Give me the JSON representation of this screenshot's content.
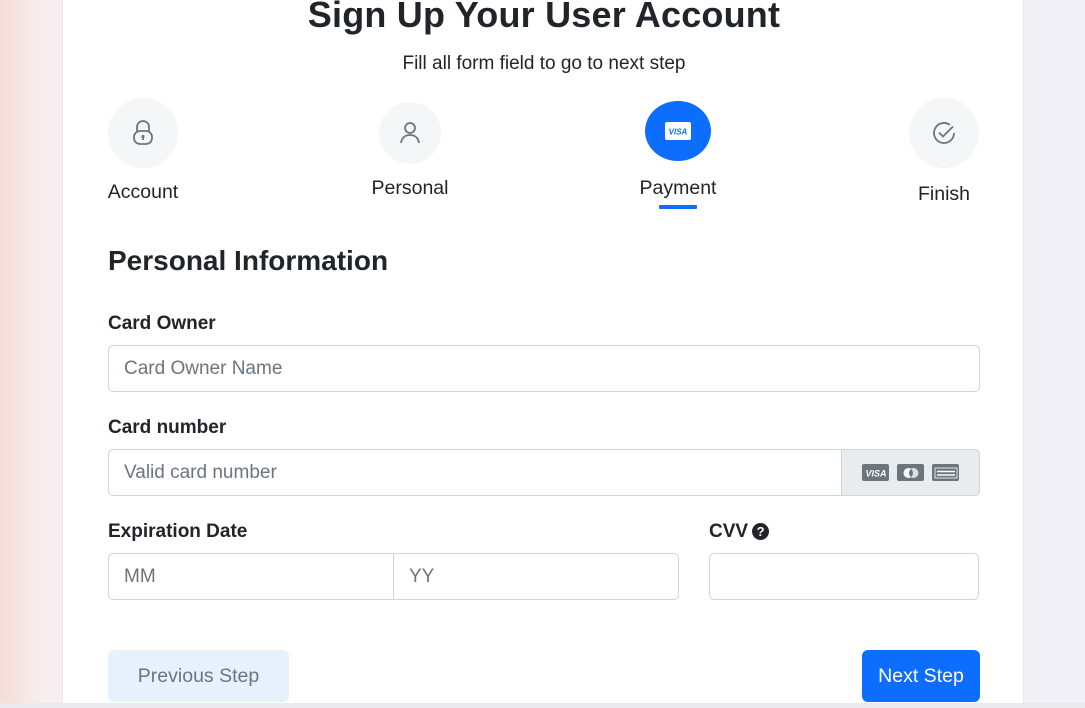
{
  "header": {
    "title": "Sign Up Your User Account",
    "subtitle": "Fill all form field to go to next step"
  },
  "steps": [
    {
      "label": "Account",
      "icon": "lock-icon",
      "active": false
    },
    {
      "label": "Personal",
      "icon": "user-icon",
      "active": false
    },
    {
      "label": "Payment",
      "icon": "visa-card-icon",
      "active": true
    },
    {
      "label": "Finish",
      "icon": "check-circle-icon",
      "active": false
    }
  ],
  "form": {
    "section_title": "Personal Information",
    "card_owner": {
      "label": "Card Owner",
      "placeholder": "Card Owner Name",
      "value": ""
    },
    "card_number": {
      "label": "Card number",
      "placeholder": "Valid card number",
      "value": "",
      "card_icons": [
        "visa-icon",
        "mastercard-icon",
        "amex-icon"
      ]
    },
    "expiration": {
      "label": "Expiration Date",
      "month_placeholder": "MM",
      "year_placeholder": "YY"
    },
    "cvv": {
      "label": "CVV",
      "placeholder": "",
      "value": ""
    }
  },
  "buttons": {
    "previous": "Previous Step",
    "next": "Next Step"
  },
  "colors": {
    "primary": "#0d6efd",
    "text": "#212529",
    "muted": "#6c757d"
  }
}
